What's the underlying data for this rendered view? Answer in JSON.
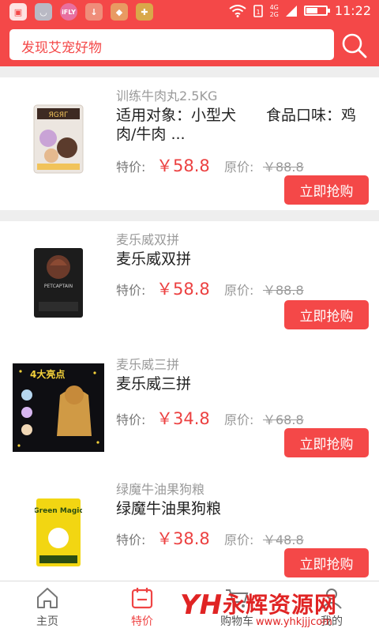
{
  "status_bar": {
    "time": "11:22",
    "network_top": "4G",
    "network_bottom": "2G",
    "battery_level": 0.6,
    "icons": [
      "gallery-icon",
      "app-icon",
      "ifly-icon",
      "download-icon",
      "shield-icon",
      "security-icon",
      "wifi-icon",
      "signal-icon",
      "battery-icon"
    ],
    "app_badge_text": "iFLY"
  },
  "header": {
    "search_placeholder": "发现艾宠好物",
    "search_icon": "search-icon",
    "color": "#f44848"
  },
  "products": [
    {
      "subtitle": "训练牛肉丸2.5KG",
      "title": "适用对象：小型犬　　食品口味：鸡肉/牛肉 ...",
      "price_label": "特价:",
      "price": "￥58.8",
      "original_label": "原价:",
      "original_price": "￥88.8",
      "buy_label": "立即抢购",
      "brand_text": "ЯGЯГ"
    },
    {
      "subtitle": "麦乐威双拼",
      "title": "麦乐威双拼",
      "price_label": "特价:",
      "price": "￥58.8",
      "original_label": "原价:",
      "original_price": "￥88.8",
      "buy_label": "立即抢购",
      "brand_text": "PETCAPTAIN"
    },
    {
      "subtitle": "麦乐威三拼",
      "title": "麦乐威三拼",
      "price_label": "特价:",
      "price": "￥34.8",
      "original_label": "原价:",
      "original_price": "￥68.8",
      "buy_label": "立即抢购",
      "brand_text": "4大亮点"
    },
    {
      "subtitle": "绿魔牛油果狗粮",
      "title": "绿魔牛油果狗粮",
      "price_label": "特价:",
      "price": "￥38.8",
      "original_label": "原价:",
      "original_price": "￥48.8",
      "buy_label": "立即抢购",
      "brand_text": "Green Magic"
    }
  ],
  "tabs": [
    {
      "label": "主页",
      "icon": "home-icon",
      "active": false
    },
    {
      "label": "特价",
      "icon": "deal-icon",
      "active": true
    },
    {
      "label": "购物车",
      "icon": "cart-icon",
      "active": false
    },
    {
      "label": "我的",
      "icon": "user-icon",
      "active": false
    }
  ],
  "watermark": {
    "logo": "YH",
    "text": "永辉资源网",
    "url": "www.yhkjjjcom"
  },
  "colors": {
    "accent": "#f44848",
    "price": "#ec4141",
    "background": "#eeeeee"
  }
}
